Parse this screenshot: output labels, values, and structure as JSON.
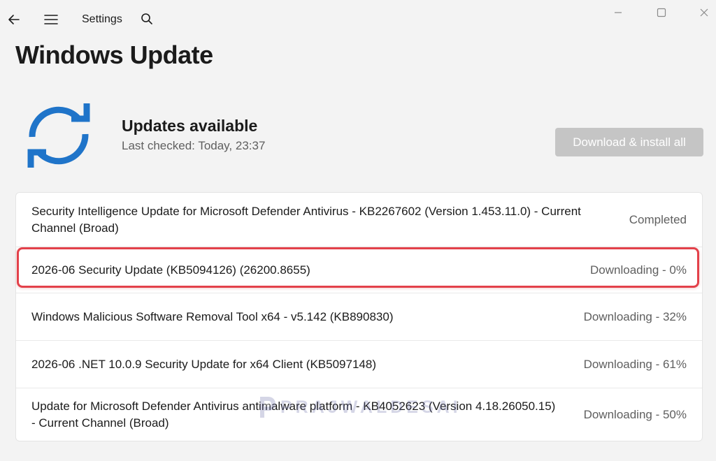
{
  "titlebar": {
    "app_title": "Settings",
    "icons": {
      "back": "back-arrow-icon",
      "menu": "hamburger-menu-icon",
      "search": "search-icon",
      "minimize": "minimize-icon",
      "maximize": "maximize-icon",
      "close": "close-icon"
    }
  },
  "page": {
    "title": "Windows Update"
  },
  "status": {
    "title": "Updates available",
    "last_checked": "Last checked: Today, 23:37",
    "icon": "sync-icon",
    "icon_color": "#1f74c9"
  },
  "actions": {
    "install_all_label": "Download & install all",
    "install_all_enabled": false
  },
  "updates": [
    {
      "name": "Security Intelligence Update for Microsoft Defender Antivirus - KB2267602 (Version 1.453.11.0) - Current Channel (Broad)",
      "status": "Completed"
    },
    {
      "name": "2026-06 Security Update (KB5094126) (26200.8655)",
      "status": "Downloading - 0%",
      "highlighted": true
    },
    {
      "name": "Windows Malicious Software Removal Tool x64 - v5.142 (KB890830)",
      "status": "Downloading - 32%"
    },
    {
      "name": "2026-06 .NET 10.0.9 Security Update for x64 Client (KB5097148)",
      "status": "Downloading - 61%"
    },
    {
      "name": "Update for Microsoft Defender Antivirus antimalware platform - KB4052623 (Version 4.18.26050.15) - Current Channel (Broad)",
      "status": "Downloading - 50%"
    }
  ],
  "highlight_color": "#e3414a",
  "watermark": {
    "text": "PRAJWALDESAI",
    "logo": "prajwaldesai-logo"
  }
}
